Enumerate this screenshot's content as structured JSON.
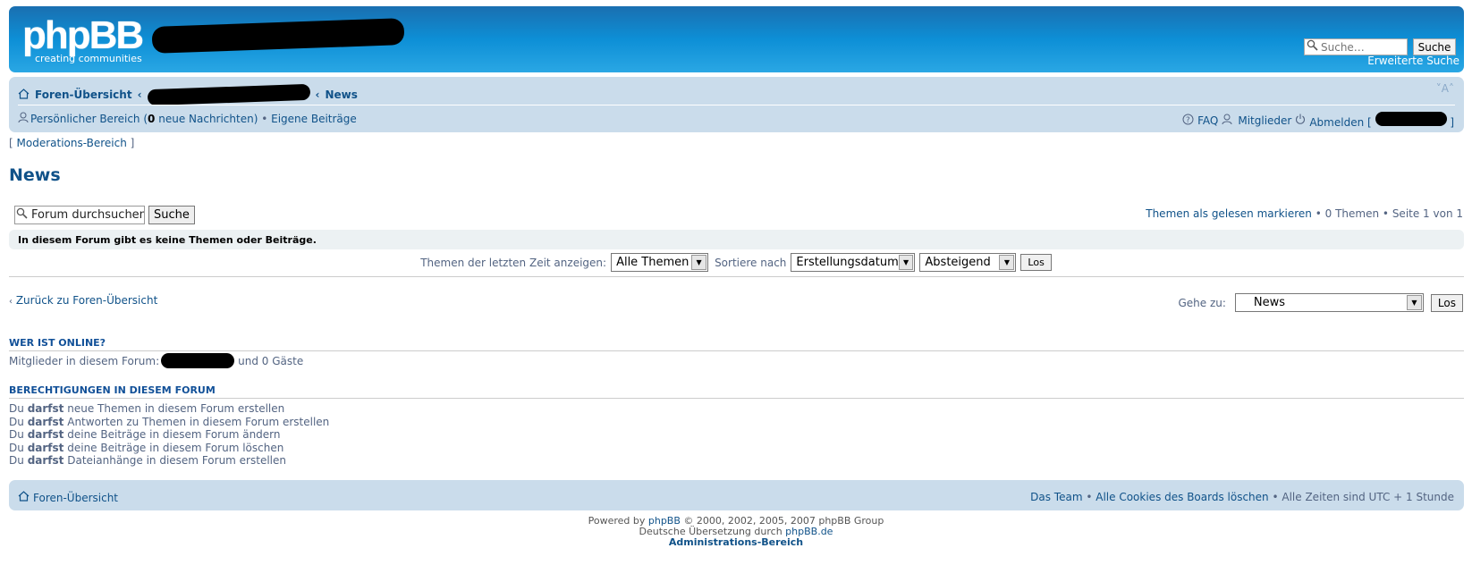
{
  "header": {
    "logo_main": "phpBB",
    "logo_sub": "creating communities",
    "search_placeholder": "Suche…",
    "search_button": "Suche",
    "advanced_search": "Erweiterte Suche"
  },
  "navbar": {
    "home": "Foren-Übersicht",
    "current": "News",
    "font_size": "˅A˄",
    "ucp_label": "Persönlicher Bereich",
    "new_pm_count": "0",
    "new_pm_suffix": "neue Nachrichten",
    "own_posts": "Eigene Beiträge",
    "faq": "FAQ",
    "members": "Mitglieder",
    "logout": "Abmelden"
  },
  "moderation_link": "Moderations-Bereich",
  "page_title": "News",
  "forum_search": {
    "placeholder": "Forum durchsuchen",
    "button": "Suche"
  },
  "pagination": {
    "mark_read": "Themen als gelesen markieren",
    "topic_count": "0 Themen",
    "page_info": "Seite 1 von 1"
  },
  "notice": "In diesem Forum gibt es keine Themen oder Beiträge.",
  "sort": {
    "display_label": "Themen der letzten Zeit anzeigen:",
    "display_value": "Alle Themen",
    "sort_label": "Sortiere nach",
    "sort_value": "Erstellungsdatum",
    "order_value": "Absteigend",
    "go_button": "Los"
  },
  "back_link": "Zurück zu Foren-Übersicht",
  "jump": {
    "label": "Gehe zu:",
    "value": "News",
    "button": "Los"
  },
  "online": {
    "title": "WER IST ONLINE?",
    "prefix": "Mitglieder in diesem Forum:",
    "suffix": "und 0 Gäste"
  },
  "permissions": {
    "title": "BERECHTIGUNGEN IN DIESEM FORUM",
    "subject": "Du",
    "verb": "darfst",
    "items": [
      "neue Themen in diesem Forum erstellen",
      "Antworten zu Themen in diesem Forum erstellen",
      "deine Beiträge in diesem Forum ändern",
      "deine Beiträge in diesem Forum löschen",
      "Dateianhänge in diesem Forum erstellen"
    ]
  },
  "footer": {
    "home": "Foren-Übersicht",
    "team": "Das Team",
    "delete_cookies": "Alle Cookies des Boards löschen",
    "timezone": "Alle Zeiten sind UTC + 1 Stunde"
  },
  "copyright": {
    "powered_by": "Powered by",
    "phpbb": "phpBB",
    "years": "© 2000, 2002, 2005, 2007 phpBB Group",
    "translation_prefix": "Deutsche Übersetzung durch",
    "translation_link": "phpBB.de",
    "admin": "Administrations-Bereich"
  }
}
